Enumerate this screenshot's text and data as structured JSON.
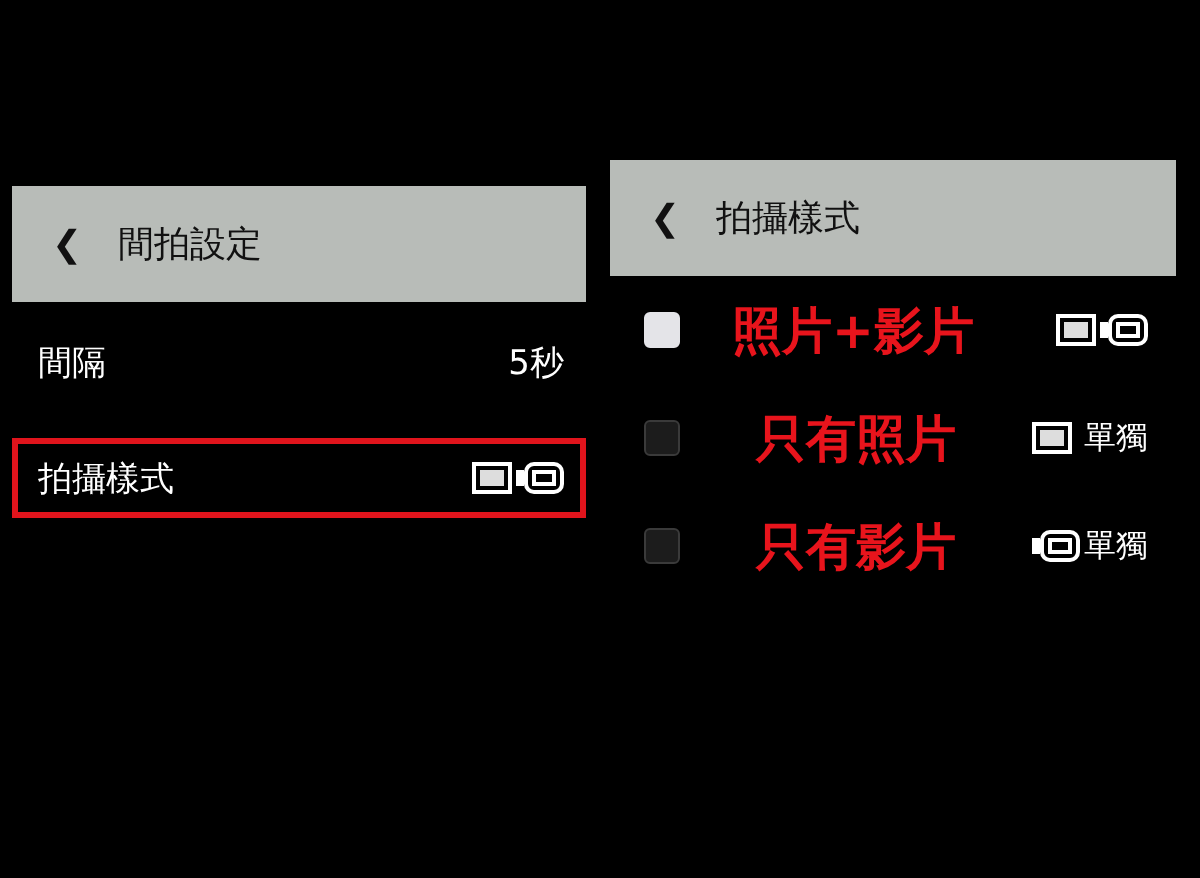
{
  "left_panel": {
    "header": {
      "back": "❮",
      "title": "間拍設定"
    },
    "rows": [
      {
        "label": "間隔",
        "value": "5秒",
        "highlighted": false
      },
      {
        "label": "拍攝樣式",
        "kind": "both",
        "highlighted": true
      }
    ]
  },
  "right_panel": {
    "header": {
      "back": "❮",
      "title": "拍攝樣式"
    },
    "options": [
      {
        "selected": true,
        "annotation": "照片+影片",
        "kind": "both"
      },
      {
        "selected": false,
        "annotation": "只有照片",
        "kind": "photo",
        "suffix": "單獨"
      },
      {
        "selected": false,
        "annotation": "只有影片",
        "kind": "video",
        "suffix": "單獨"
      }
    ]
  }
}
